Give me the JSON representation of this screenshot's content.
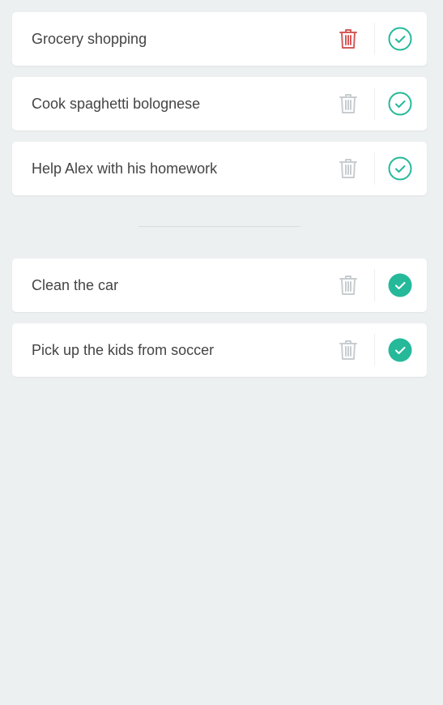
{
  "colors": {
    "background": "#EDF0F1",
    "card": "#FFFFFF",
    "text": "#444444",
    "trash_active": "#D55A5A",
    "trash_muted": "#C8CDD0",
    "accent_green": "#25B99A"
  },
  "icons": {
    "remove": "trash-icon",
    "complete": "check-circle-icon",
    "completed": "check-circle-filled-icon"
  },
  "todo": {
    "items": [
      {
        "label": "Grocery shopping",
        "remove_state": "active",
        "completed": false
      },
      {
        "label": "Cook spaghetti bolognese",
        "remove_state": "muted",
        "completed": false
      },
      {
        "label": "Help Alex with his homework",
        "remove_state": "muted",
        "completed": false
      }
    ]
  },
  "completed": {
    "items": [
      {
        "label": "Clean the car",
        "remove_state": "muted",
        "completed": true
      },
      {
        "label": "Pick up the kids from soccer",
        "remove_state": "muted",
        "completed": true
      }
    ]
  }
}
